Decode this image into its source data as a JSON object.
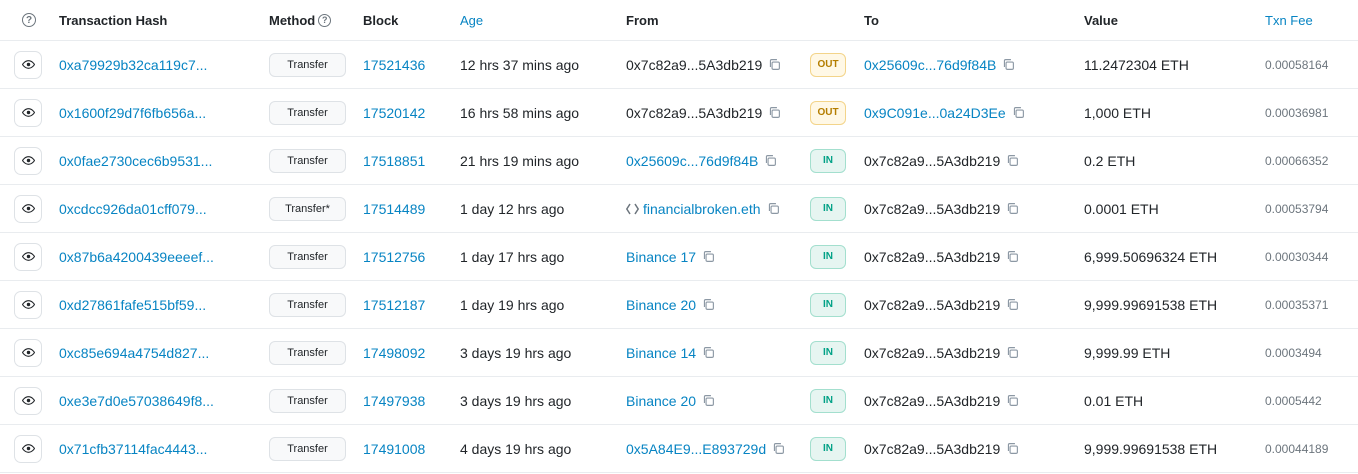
{
  "header": {
    "transaction_hash": "Transaction Hash",
    "method": "Method",
    "block": "Block",
    "age": "Age",
    "from": "From",
    "to": "To",
    "value": "Value",
    "txn_fee": "Txn Fee",
    "help_icon": "question-circle-icon"
  },
  "colors": {
    "link": "#0784c3",
    "out_badge_bg": "#fff8e6",
    "out_badge_text": "#b47d00",
    "in_badge_bg": "#e6f5f1",
    "in_badge_text": "#00a186"
  },
  "rows": [
    {
      "hash": "0xa79929b32ca119c7...",
      "method": "Transfer",
      "block": "17521436",
      "age": "12 hrs 37 mins ago",
      "from": "0x7c82a9...5A3db219",
      "from_link": false,
      "dir": "OUT",
      "to": "0x25609c...76d9f84B",
      "to_link": true,
      "value": "11.2472304 ETH",
      "fee": "0.00058164"
    },
    {
      "hash": "0x1600f29d7f6fb656a...",
      "method": "Transfer",
      "block": "17520142",
      "age": "16 hrs 58 mins ago",
      "from": "0x7c82a9...5A3db219",
      "from_link": false,
      "dir": "OUT",
      "to": "0x9C091e...0a24D3Ee",
      "to_link": true,
      "value": "1,000 ETH",
      "fee": "0.00036981"
    },
    {
      "hash": "0x0fae2730cec6b9531...",
      "method": "Transfer",
      "block": "17518851",
      "age": "21 hrs 19 mins ago",
      "from": "0x25609c...76d9f84B",
      "from_link": true,
      "dir": "IN",
      "to": "0x7c82a9...5A3db219",
      "to_link": false,
      "value": "0.2 ETH",
      "fee": "0.00066352"
    },
    {
      "hash": "0xcdcc926da01cff079...",
      "method": "Transfer*",
      "block": "17514489",
      "age": "1 day 12 hrs ago",
      "from": "financialbroken.eth",
      "from_link": true,
      "from_ens": true,
      "dir": "IN",
      "to": "0x7c82a9...5A3db219",
      "to_link": false,
      "value": "0.0001 ETH",
      "fee": "0.00053794"
    },
    {
      "hash": "0x87b6a4200439eeeef...",
      "method": "Transfer",
      "block": "17512756",
      "age": "1 day 17 hrs ago",
      "from": "Binance 17",
      "from_link": true,
      "dir": "IN",
      "to": "0x7c82a9...5A3db219",
      "to_link": false,
      "value": "6,999.50696324 ETH",
      "fee": "0.00030344"
    },
    {
      "hash": "0xd27861fafe515bf59...",
      "method": "Transfer",
      "block": "17512187",
      "age": "1 day 19 hrs ago",
      "from": "Binance 20",
      "from_link": true,
      "dir": "IN",
      "to": "0x7c82a9...5A3db219",
      "to_link": false,
      "value": "9,999.99691538 ETH",
      "fee": "0.00035371"
    },
    {
      "hash": "0xc85e694a4754d827...",
      "method": "Transfer",
      "block": "17498092",
      "age": "3 days 19 hrs ago",
      "from": "Binance 14",
      "from_link": true,
      "dir": "IN",
      "to": "0x7c82a9...5A3db219",
      "to_link": false,
      "value": "9,999.99 ETH",
      "fee": "0.0003494"
    },
    {
      "hash": "0xe3e7d0e57038649f8...",
      "method": "Transfer",
      "block": "17497938",
      "age": "3 days 19 hrs ago",
      "from": "Binance 20",
      "from_link": true,
      "dir": "IN",
      "to": "0x7c82a9...5A3db219",
      "to_link": false,
      "value": "0.01 ETH",
      "fee": "0.0005442"
    },
    {
      "hash": "0x71cfb37114fac4443...",
      "method": "Transfer",
      "block": "17491008",
      "age": "4 days 19 hrs ago",
      "from": "0x5A84E9...E893729d",
      "from_link": true,
      "dir": "IN",
      "to": "0x7c82a9...5A3db219",
      "to_link": false,
      "value": "9,999.99691538 ETH",
      "fee": "0.00044189"
    }
  ]
}
